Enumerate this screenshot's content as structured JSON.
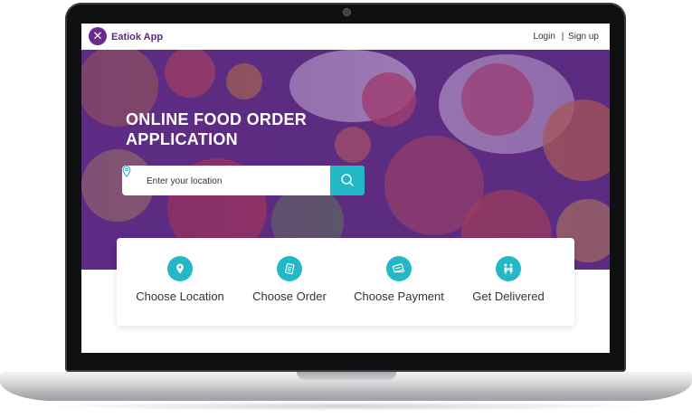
{
  "app": {
    "name": "Eatiok App",
    "logo_glyph": "✕"
  },
  "header": {
    "login": "Login",
    "separator": "|",
    "signup": "Sign up"
  },
  "hero": {
    "title_line1": "ONLINE FOOD ORDER",
    "title_line2": "APPLICATION",
    "search": {
      "placeholder": "Enter your location",
      "icon": "search-icon"
    }
  },
  "steps": [
    {
      "label": "Choose Location",
      "icon": "location-pin-icon"
    },
    {
      "label": "Choose Order",
      "icon": "receipt-icon"
    },
    {
      "label": "Choose Payment",
      "icon": "payment-card-icon"
    },
    {
      "label": "Get Delivered",
      "icon": "delivery-person-icon"
    }
  ],
  "colors": {
    "brand_purple": "#6b2c8e",
    "accent_teal": "#22b8c8"
  }
}
